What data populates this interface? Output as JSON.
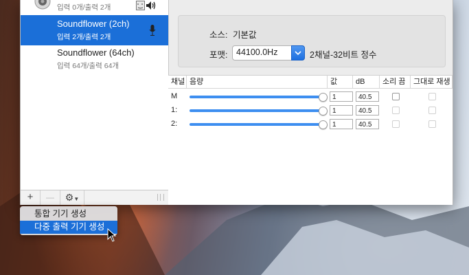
{
  "devices": [
    {
      "name": "",
      "io": "입력 0개/출력 2개"
    },
    {
      "name": "Soundflower (2ch)",
      "io": "입력 2개/출력 2개"
    },
    {
      "name": "Soundflower (64ch)",
      "io": "입력 64개/출력 64개"
    }
  ],
  "toolbar": {
    "add": "+",
    "remove": "—",
    "gear": "⚙"
  },
  "format": {
    "source_label": "소스:",
    "source_value": "기본값",
    "format_label": "포맷:",
    "rate_value": "44100.0Hz",
    "bit_format": "2채널-32비트 정수"
  },
  "table": {
    "headers": [
      "채널",
      "음량",
      "값",
      "dB",
      "소리 끔",
      "그대로 재생"
    ],
    "rows": [
      {
        "channel": "M",
        "value": "1",
        "db": "40.5",
        "level": 1.0
      },
      {
        "channel": "1:",
        "value": "1",
        "db": "40.5",
        "level": 1.0
      },
      {
        "channel": "2:",
        "value": "1",
        "db": "40.5",
        "level": 1.0
      }
    ]
  },
  "context_menu": {
    "items": [
      "통합 기기 생성",
      "다중 출력 기기 생성"
    ],
    "highlighted": 1
  },
  "colors": {
    "accent": "#1b6fd8",
    "slider": "#3d8ef0"
  }
}
